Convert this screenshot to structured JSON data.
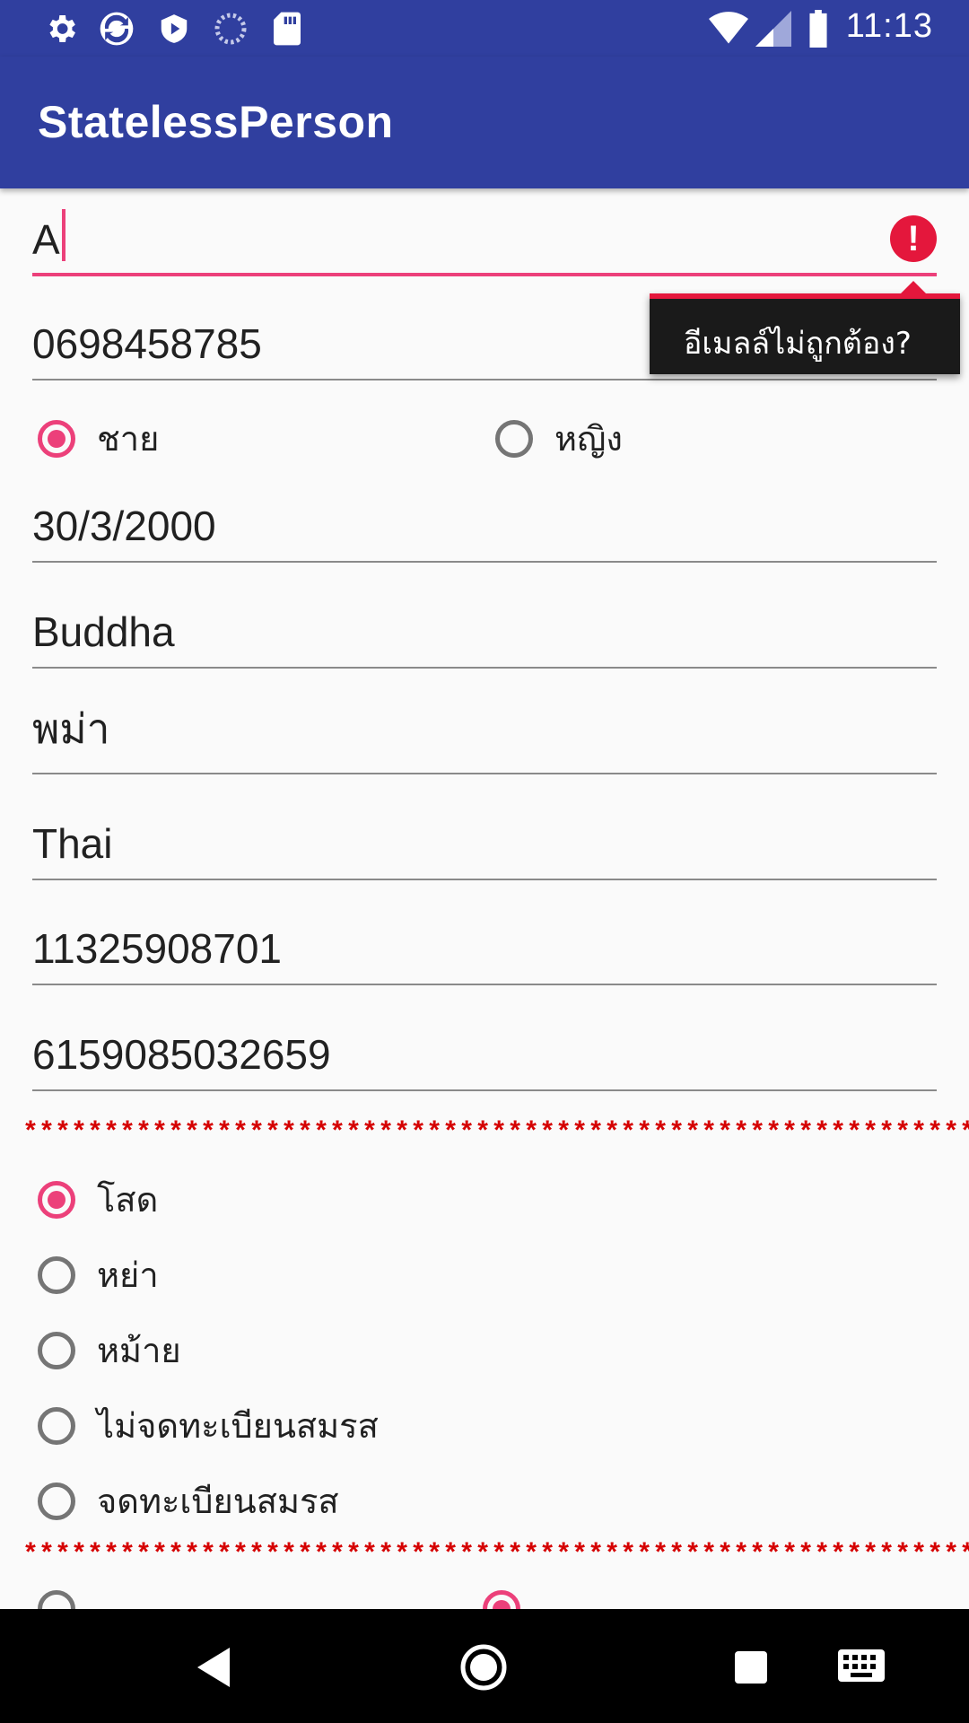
{
  "status_bar": {
    "time": "11:13",
    "icons": [
      "gear-icon",
      "sync-icon",
      "shield-play-icon",
      "loading-icon",
      "sd-card-icon",
      "wifi-icon",
      "signal-icon",
      "battery-icon"
    ]
  },
  "app_bar": {
    "title": "StatelessPerson"
  },
  "form": {
    "email_value": "A",
    "email_error": "อีเมลล์ไม่ถูกต้อง?",
    "phone_value": "0698458785",
    "gender": {
      "options": [
        "ชาย",
        "หญิง"
      ],
      "selected": "ชาย"
    },
    "birthdate_value": "30/3/2000",
    "religion_value": "Buddha",
    "race_value": "พม่า",
    "nationality_value": "Thai",
    "id_value": "11325908701",
    "number_value": "6159085032659",
    "separator_1": "*************************************************************",
    "marital": {
      "options": [
        "โสด",
        "หย่า",
        "หม้าย",
        "ไม่จดทะเบียนสมรส",
        "จดทะเบียนสมรส"
      ],
      "selected": "โสด"
    },
    "separator_2": "*************************************************************"
  },
  "colors": {
    "primary": "#303f9f",
    "accent": "#ec407a",
    "error": "#e4173c",
    "separator": "#d50000"
  }
}
